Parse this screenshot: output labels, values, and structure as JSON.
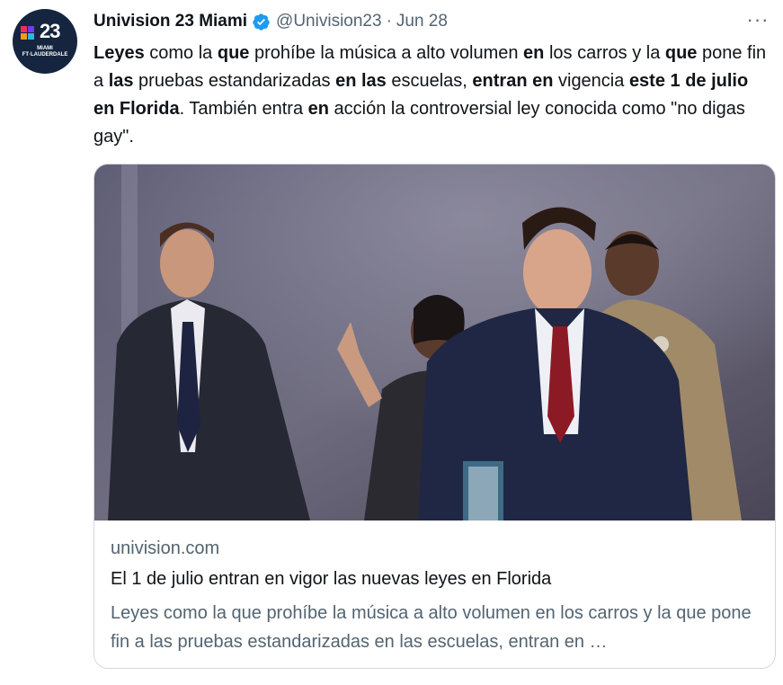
{
  "account": {
    "avatar_number": "23",
    "avatar_line1": "MIAMI",
    "avatar_line2": "FT·LAUDERDALE",
    "name": "Univision 23 Miami",
    "handle": "@Univision23",
    "separator": "·",
    "date": "Jun 28",
    "verified": true
  },
  "more_label": "···",
  "tweet_segments": [
    {
      "text": "Leyes",
      "bold": true
    },
    {
      "text": " como la ",
      "bold": false
    },
    {
      "text": "que",
      "bold": true
    },
    {
      "text": " prohíbe la música a alto volumen ",
      "bold": false
    },
    {
      "text": "en",
      "bold": true
    },
    {
      "text": " los carros y la ",
      "bold": false
    },
    {
      "text": "que",
      "bold": true
    },
    {
      "text": " pone fin a ",
      "bold": false
    },
    {
      "text": "las",
      "bold": true
    },
    {
      "text": " pruebas estandarizadas ",
      "bold": false
    },
    {
      "text": "en las",
      "bold": true
    },
    {
      "text": " escuelas, ",
      "bold": false
    },
    {
      "text": "entran en",
      "bold": true
    },
    {
      "text": " vigencia ",
      "bold": false
    },
    {
      "text": "este 1 de julio en Florida",
      "bold": true
    },
    {
      "text": ". También entra ",
      "bold": false
    },
    {
      "text": "en",
      "bold": true
    },
    {
      "text": " acción la controversial ley conocida como \"no digas gay\".",
      "bold": false
    }
  ],
  "card": {
    "domain": "univision.com",
    "title": "El 1 de julio entran en vigor las nuevas leyes en Florida",
    "description": "Leyes como la que prohíbe la música a alto volumen en los carros y la que pone fin a las pruebas estandarizadas en las escuelas, entran en …"
  },
  "colors": {
    "verified": "#1d9bf0",
    "secondary_text": "#536471",
    "border": "#cfd9de",
    "avatar_bg": "#15243f"
  },
  "icons": {
    "verified": "verified-badge-icon",
    "more": "more-options-icon"
  }
}
